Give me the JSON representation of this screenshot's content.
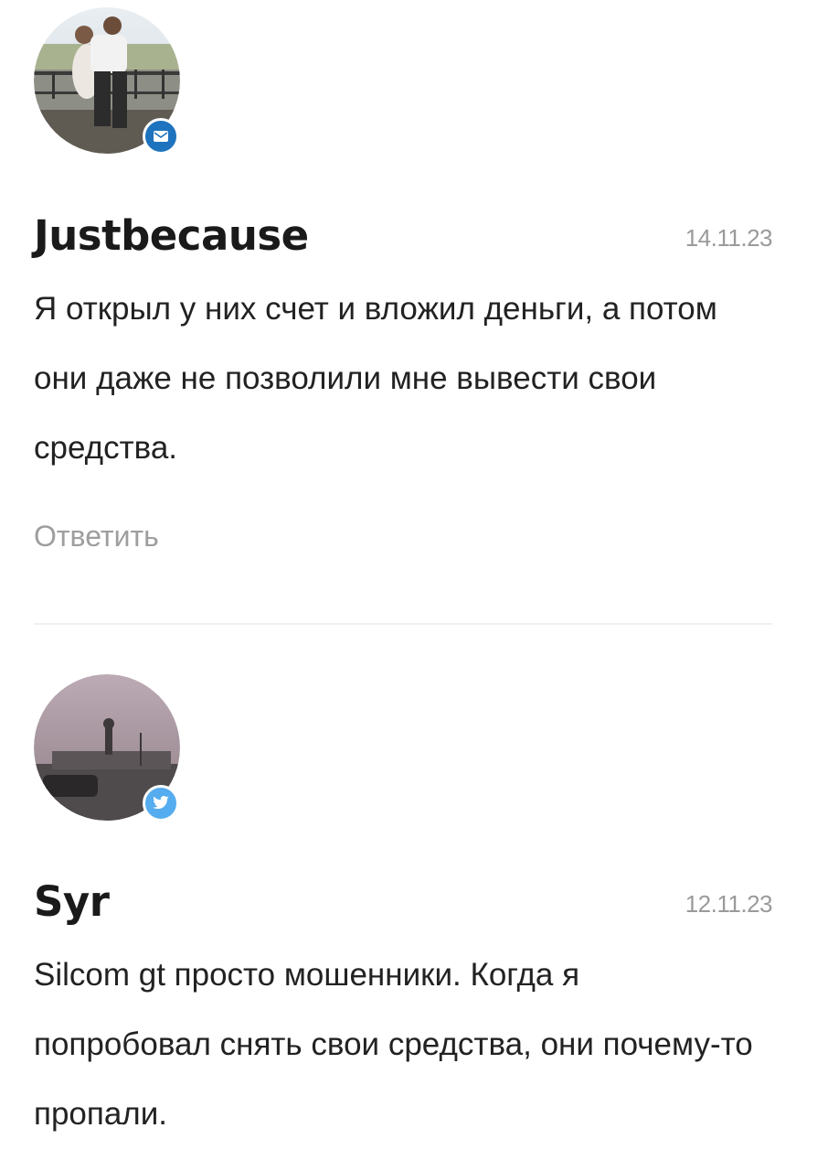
{
  "comments": [
    {
      "author": "Justbecause",
      "date": "14.11.23",
      "text": "Я открыл у них счет и вложил деньги, а потом они даже не позволили мне вывести свои средства.",
      "reply_label": "Ответить",
      "badge_icon": "mail-icon",
      "badge_color": "#1e73be"
    },
    {
      "author": "Syr",
      "date": "12.11.23",
      "text": "Silcom gt просто мошенники. Когда я попробовал снять свои средства, они почему-то пропали.",
      "badge_icon": "twitter-icon",
      "badge_color": "#55acee"
    }
  ]
}
